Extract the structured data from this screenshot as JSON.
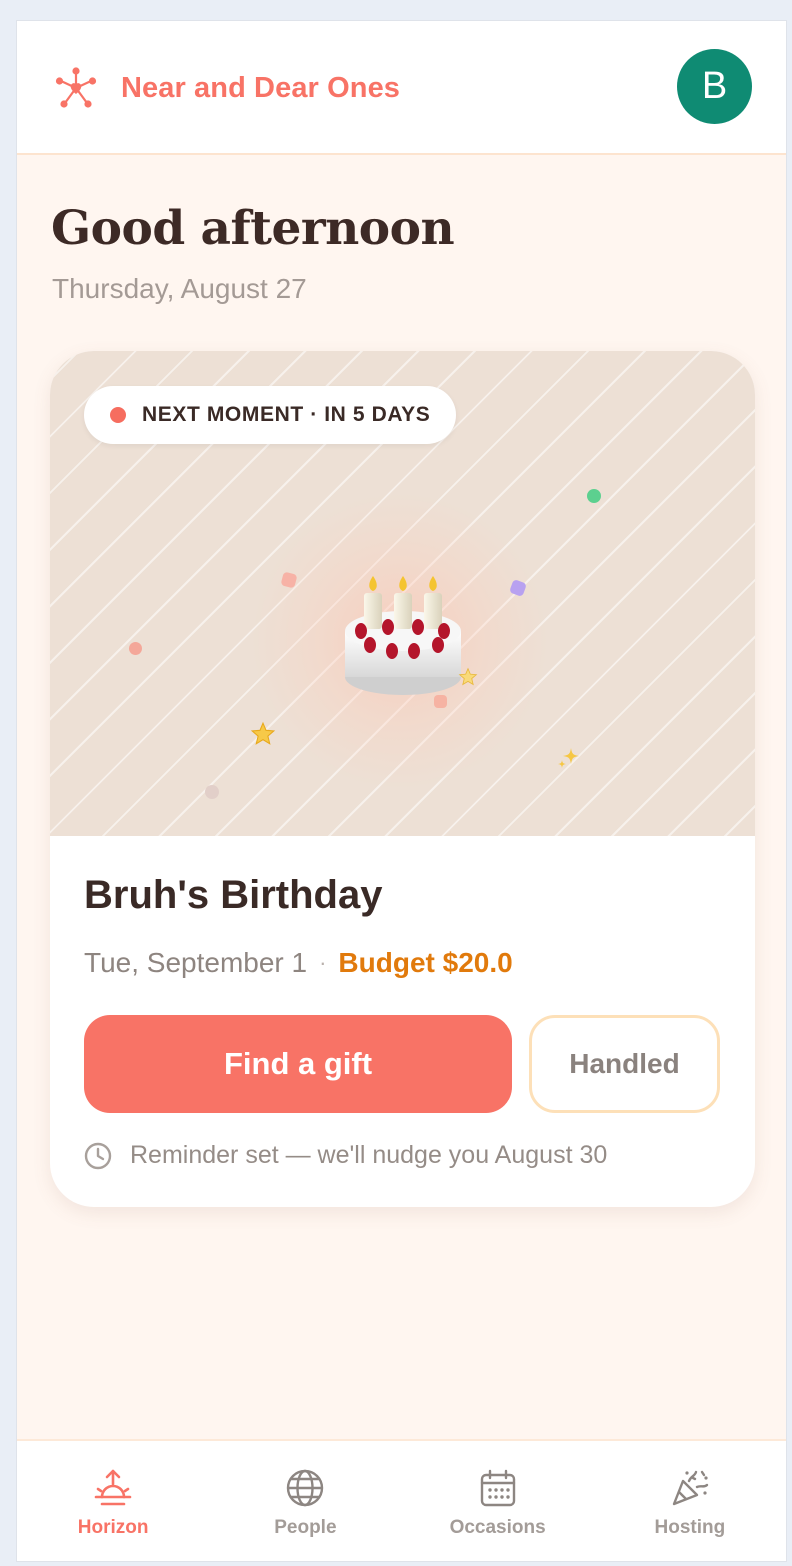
{
  "header": {
    "app_name": "Near and Dear Ones",
    "logo_icon": "network-heart-icon",
    "avatar_initial": "B",
    "avatar_color": "#0f8b73"
  },
  "greeting": {
    "title": "Good afternoon",
    "date": "Thursday, August 27"
  },
  "moment_card": {
    "badge": "NEXT MOMENT · IN 5 DAYS",
    "hero_icon": "birthday-cake-icon",
    "title": "Bruh's Birthday",
    "date": "Tue, September 1",
    "separator": "·",
    "budget": "Budget $20.0",
    "primary_button": "Find a gift",
    "secondary_button": "Handled",
    "reminder": "Reminder set — we'll nudge you August 30"
  },
  "nav": {
    "items": [
      {
        "label": "Horizon",
        "icon": "sunrise-icon",
        "active": true
      },
      {
        "label": "People",
        "icon": "globe-icon",
        "active": false
      },
      {
        "label": "Occasions",
        "icon": "calendar-icon",
        "active": false
      },
      {
        "label": "Hosting",
        "icon": "party-popper-icon",
        "active": false
      }
    ]
  },
  "colors": {
    "brand": "#f87366",
    "budget": "#e17a0c",
    "background": "#fff6f0"
  }
}
